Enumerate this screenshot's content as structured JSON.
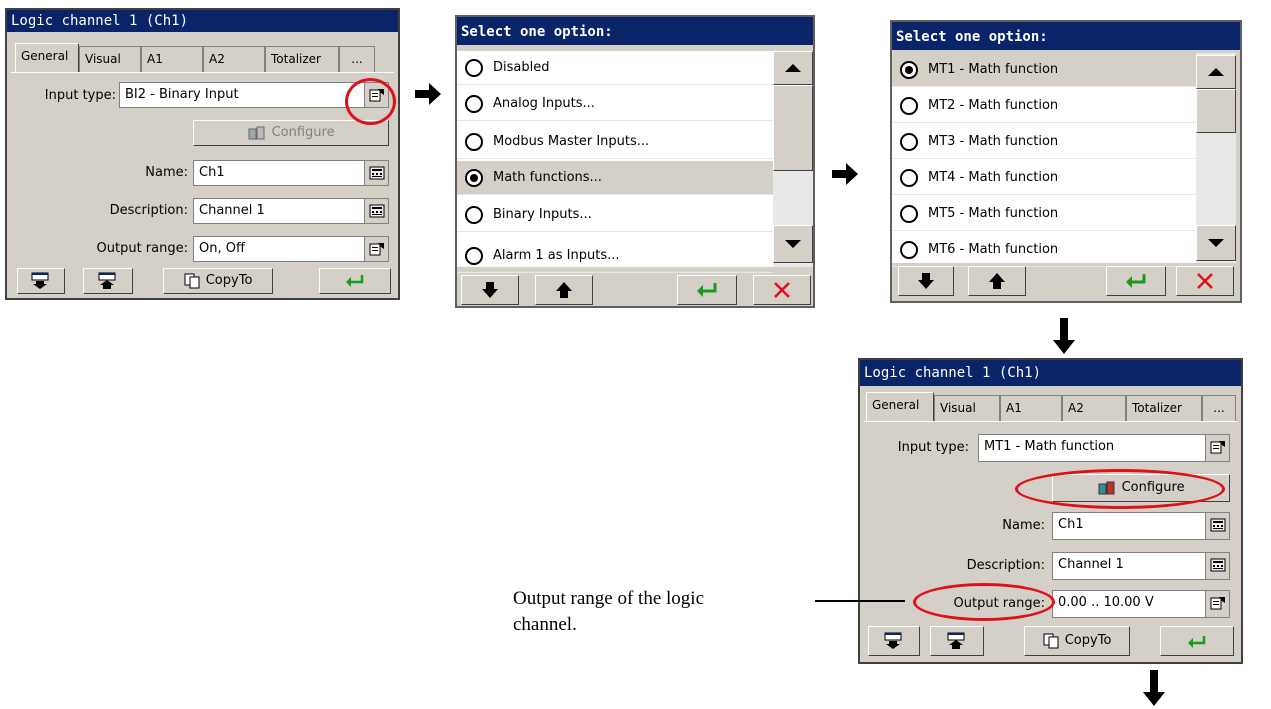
{
  "panel1": {
    "title": "Logic channel 1 (Ch1)",
    "tabs": [
      "General",
      "Visual",
      "A1",
      "A2",
      "Totalizer",
      "..."
    ],
    "input_type_label": "Input type:",
    "input_type_value": "BI2 - Binary Input",
    "configure_label": "Configure",
    "name_label": "Name:",
    "name_value": "Ch1",
    "description_label": "Description:",
    "description_value": "Channel 1",
    "output_range_label": "Output range:",
    "output_range_value": "On, Off",
    "copyto_label": "CopyTo"
  },
  "panel2": {
    "title": "Select one option:",
    "options": [
      {
        "label": "Disabled",
        "selected": false
      },
      {
        "label": "Analog Inputs...",
        "selected": false
      },
      {
        "label": "Modbus Master Inputs...",
        "selected": false
      },
      {
        "label": "Math functions...",
        "selected": true
      },
      {
        "label": "Binary Inputs...",
        "selected": false
      },
      {
        "label": "Alarm 1 as Inputs...",
        "selected": false
      }
    ]
  },
  "panel3": {
    "title": "Select one option:",
    "options": [
      {
        "label": "MT1 - Math function",
        "selected": true
      },
      {
        "label": "MT2 - Math function",
        "selected": false
      },
      {
        "label": "MT3 - Math function",
        "selected": false
      },
      {
        "label": "MT4 - Math function",
        "selected": false
      },
      {
        "label": "MT5 - Math function",
        "selected": false
      },
      {
        "label": "MT6 - Math function",
        "selected": false
      }
    ]
  },
  "panel4": {
    "title": "Logic channel 1 (Ch1)",
    "tabs": [
      "General",
      "Visual",
      "A1",
      "A2",
      "Totalizer",
      "..."
    ],
    "input_type_label": "Input type:",
    "input_type_value": "MT1 - Math function",
    "configure_label": "Configure",
    "name_label": "Name:",
    "name_value": "Ch1",
    "description_label": "Description:",
    "description_value": "Channel 1",
    "output_range_label": "Output range:",
    "output_range_value": "0.00 .. 10.00 V",
    "copyto_label": "CopyTo"
  },
  "caption": {
    "line1": "Output range of the logic",
    "line2": "channel."
  },
  "colors": {
    "titlebar": "#0a246a",
    "highlight": "#e0101a",
    "enter_arrow": "#1a9a1a"
  }
}
